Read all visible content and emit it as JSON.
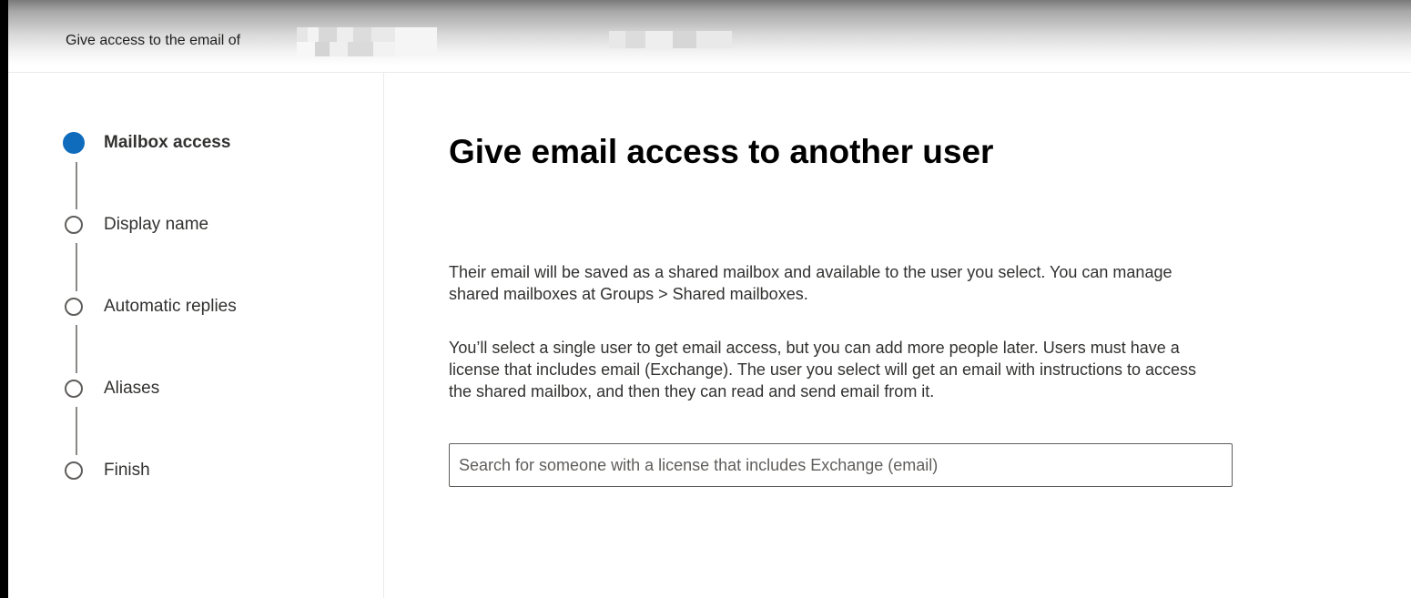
{
  "header": {
    "title": "Give access to the email of"
  },
  "wizard": {
    "steps": [
      {
        "label": "Mailbox access",
        "state": "active"
      },
      {
        "label": "Display name",
        "state": "pending"
      },
      {
        "label": "Automatic replies",
        "state": "pending"
      },
      {
        "label": "Aliases",
        "state": "pending"
      },
      {
        "label": "Finish",
        "state": "pending"
      }
    ]
  },
  "main": {
    "title": "Give email access to another user",
    "paragraph1": "Their email will be saved as a shared mailbox and available to the user you select. You can manage shared mailboxes at Groups > Shared mailboxes.",
    "paragraph2": "You’ll select a single user to get email access, but you can add more people later. Users must have a license that includes email (Exchange). The user you select will get an email with instructions to access the shared mailbox, and then they can read and send email from it.",
    "search": {
      "value": "",
      "placeholder": "Search for someone with a license that includes Exchange (email)"
    }
  },
  "colors": {
    "accent": "#0f6cbd",
    "text": "#323130",
    "border": "#605e5c"
  }
}
